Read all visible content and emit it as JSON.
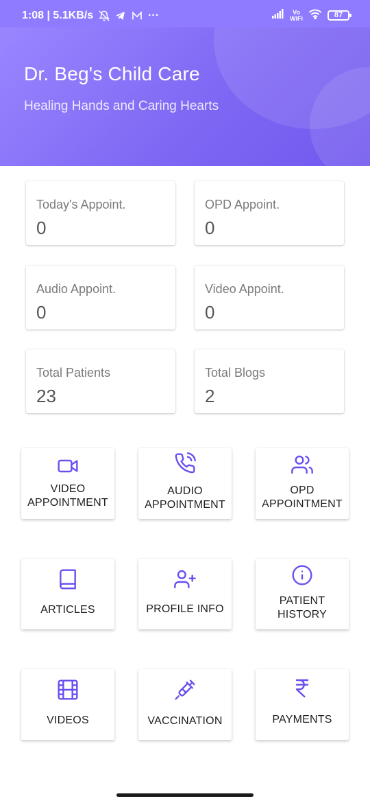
{
  "status_bar": {
    "time_speed": "1:08 | 5.1KB/s",
    "more": "···",
    "vowifi_top": "Vo",
    "vowifi_bottom": "WiFi",
    "battery": "87"
  },
  "header": {
    "title": "Dr. Beg's Child Care",
    "subtitle": "Healing Hands and Caring Hearts"
  },
  "stats": [
    {
      "label": "Today's Appoint.",
      "value": "0"
    },
    {
      "label": "OPD Appoint.",
      "value": "0"
    },
    {
      "label": "Audio Appoint.",
      "value": "0"
    },
    {
      "label": "Video Appoint.",
      "value": "0"
    },
    {
      "label": "Total Patients",
      "value": "23"
    },
    {
      "label": "Total Blogs",
      "value": "2"
    }
  ],
  "actions": [
    {
      "line1": "VIDEO",
      "line2": "APPOINTMENT",
      "icon": "video-icon"
    },
    {
      "line1": "AUDIO",
      "line2": "APPOINTMENT",
      "icon": "phone-call-icon"
    },
    {
      "line1": "OPD",
      "line2": "APPOINTMENT",
      "icon": "users-icon"
    },
    {
      "line1": "ARTICLES",
      "line2": "",
      "icon": "book-icon"
    },
    {
      "line1": "PROFILE INFO",
      "line2": "",
      "icon": "user-plus-icon"
    },
    {
      "line1": "PATIENT",
      "line2": "HISTORY",
      "icon": "info-icon"
    },
    {
      "line1": "VIDEOS",
      "line2": "",
      "icon": "film-icon"
    },
    {
      "line1": "VACCINATION",
      "line2": "",
      "icon": "syringe-icon"
    },
    {
      "line1": "PAYMENTS",
      "line2": "",
      "icon": "rupee-icon"
    }
  ],
  "colors": {
    "accent": "#6a4ff0",
    "header_start": "#9a86ff",
    "header_end": "#7158ee"
  }
}
